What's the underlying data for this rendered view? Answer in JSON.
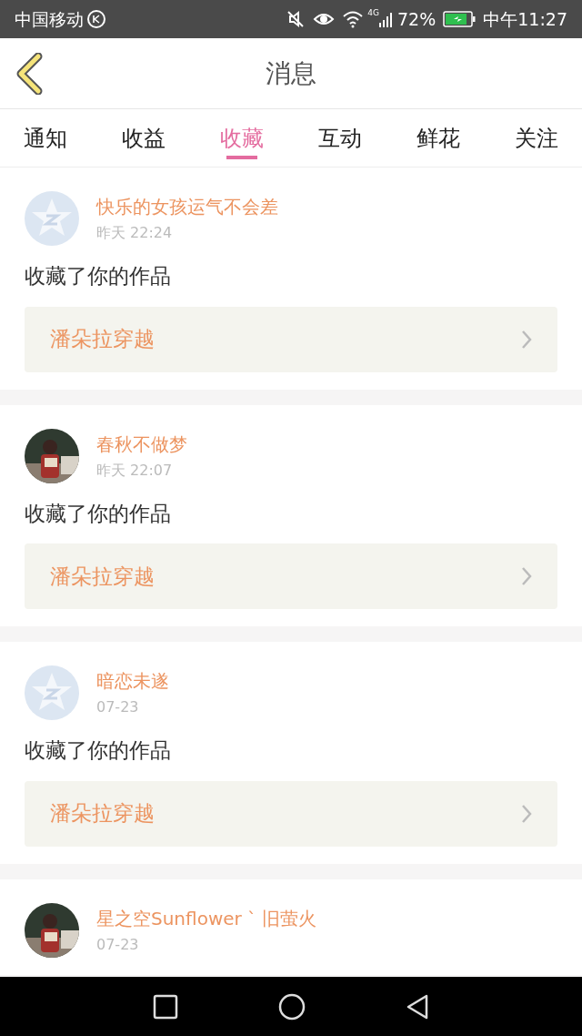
{
  "status_bar": {
    "carrier": "中国移动",
    "battery": "72%",
    "network": "4G",
    "time": "中午11:27"
  },
  "header": {
    "title": "消息"
  },
  "tabs": [
    {
      "label": "通知",
      "selected": false
    },
    {
      "label": "收益",
      "selected": false
    },
    {
      "label": "收藏",
      "selected": true
    },
    {
      "label": "互动",
      "selected": false
    },
    {
      "label": "鲜花",
      "selected": false
    },
    {
      "label": "关注",
      "selected": false
    }
  ],
  "messages": [
    {
      "avatar": {
        "kind": "default"
      },
      "name": "快乐的女孩运气不会差",
      "time": "昨天 22:24",
      "action": "收藏了你的作品",
      "work": "潘朵拉穿越"
    },
    {
      "name": "春秋不做梦",
      "time": "昨天 22:07",
      "action": "收藏了你的作品",
      "work": "潘朵拉穿越"
    },
    {
      "avatar": {
        "kind": "default"
      },
      "name": "暗恋未遂",
      "time": "07-23",
      "action": "收藏了你的作品",
      "work": "潘朵拉穿越"
    },
    {
      "name": "星之空Sunflower ˋ 旧萤火",
      "time": "07-23"
    }
  ]
}
